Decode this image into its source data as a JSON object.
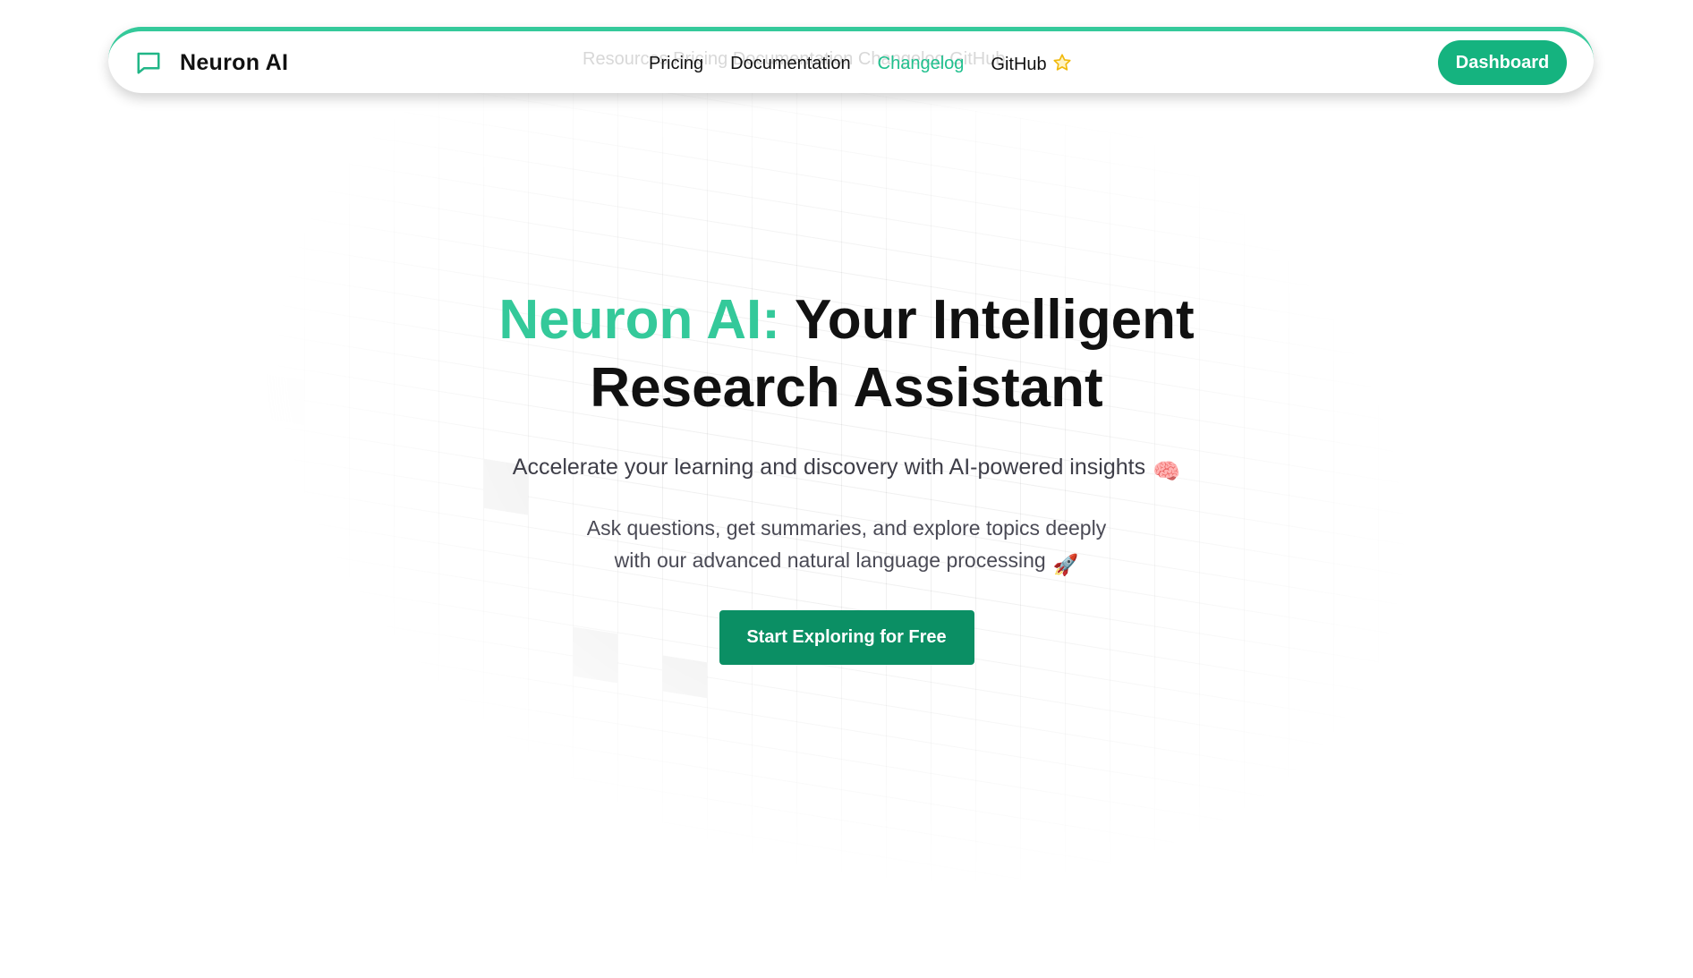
{
  "brand": {
    "name": "Neuron AI",
    "accent_color": "#34c99a",
    "logo_icon": "chat-bubble-icon"
  },
  "nav": {
    "ghost_text": "Resources   Pricing   Documentation   Changelog   GitHub",
    "links": [
      {
        "label": "Pricing"
      },
      {
        "label": "Documentation"
      },
      {
        "label": "Changelog",
        "active": true
      },
      {
        "label": "GitHub",
        "icon": "star-icon"
      }
    ],
    "dashboard_label": "Dashboard",
    "dashboard_color": "#15b37f"
  },
  "hero": {
    "title_accent": "Neuron AI:",
    "title_rest": " Your Intelligent Research Assistant",
    "subtitle": "Accelerate your learning and discovery with AI-powered insights",
    "subtitle_emoji": "🧠",
    "description_line1": "Ask questions, get summaries, and explore topics deeply",
    "description_line2": "with our advanced natural language processing",
    "description_emoji": "🚀",
    "cta_label": "Start Exploring for Free",
    "cta_color": "#0b8f64"
  }
}
